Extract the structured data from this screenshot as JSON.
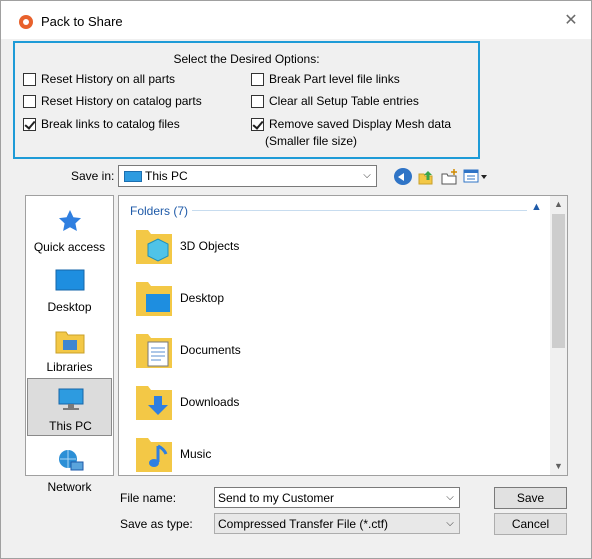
{
  "window": {
    "title": "Pack to Share",
    "close_glyph": "✕"
  },
  "options": {
    "heading": "Select the Desired Options:",
    "items": [
      {
        "label": "Reset History on all parts",
        "checked": false
      },
      {
        "label": "Reset History on catalog parts",
        "checked": false
      },
      {
        "label": "Break links to catalog files",
        "checked": true
      },
      {
        "label": "Break Part level file links",
        "checked": false
      },
      {
        "label": "Clear all Setup Table entries",
        "checked": false
      },
      {
        "label": "Remove saved Display Mesh data",
        "checked": true
      }
    ],
    "sub_note": "(Smaller file size)"
  },
  "save_in": {
    "label": "Save in:",
    "value": "This PC"
  },
  "nav": [
    {
      "label": "Quick access",
      "icon": "star-icon",
      "selected": false
    },
    {
      "label": "Desktop",
      "icon": "desktop-icon",
      "selected": false
    },
    {
      "label": "Libraries",
      "icon": "libraries-icon",
      "selected": false
    },
    {
      "label": "This PC",
      "icon": "this-pc-icon",
      "selected": true
    },
    {
      "label": "Network",
      "icon": "network-icon",
      "selected": false
    }
  ],
  "files": {
    "group_label": "Folders (7)",
    "folders": [
      {
        "name": "3D Objects",
        "icon": "3d-objects-folder-icon"
      },
      {
        "name": "Desktop",
        "icon": "desktop-folder-icon"
      },
      {
        "name": "Documents",
        "icon": "documents-folder-icon"
      },
      {
        "name": "Downloads",
        "icon": "downloads-folder-icon"
      },
      {
        "name": "Music",
        "icon": "music-folder-icon"
      }
    ]
  },
  "form": {
    "file_name_label": "File name:",
    "file_name_value": "Send to my Customer",
    "save_type_label": "Save as type:",
    "save_type_value": "Compressed Transfer File (*.ctf)",
    "save_button": "Save",
    "cancel_button": "Cancel"
  },
  "colors": {
    "accent_border": "#1e9bd7",
    "group_header": "#1e5aa8",
    "folder_yellow": "#f3c846"
  }
}
